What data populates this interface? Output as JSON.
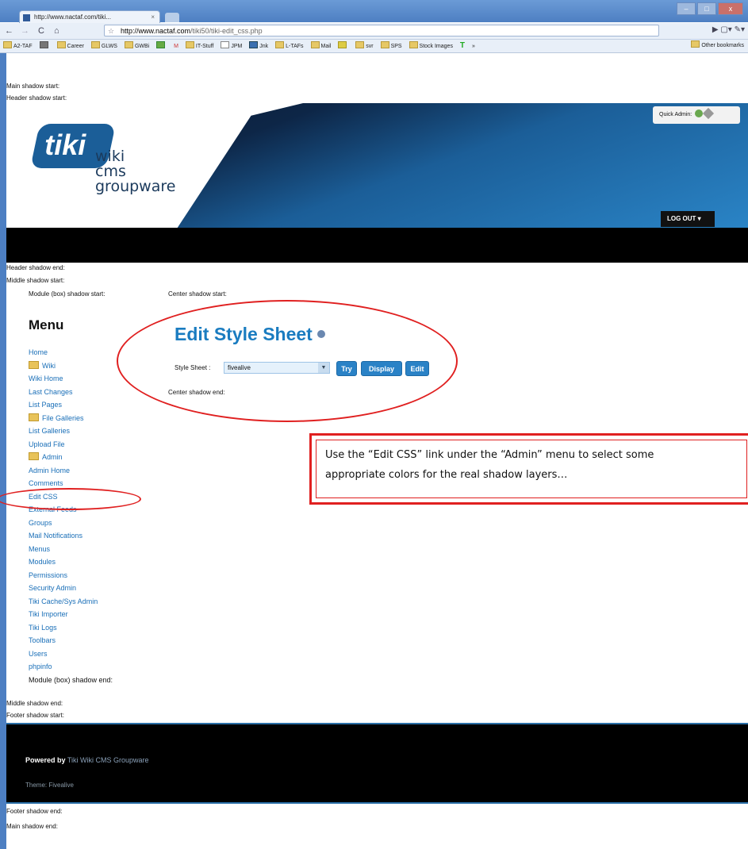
{
  "browser": {
    "tab_title": "http://www.nactaf.com/tiki...",
    "tab_close": "×",
    "url_host": "http://www.nactaf.com",
    "url_path": "/tiki50/tiki-edit_css.php",
    "bookmarks": [
      "A2-TAF",
      "",
      "Career",
      "GLWS",
      "GWBi",
      "",
      "M",
      "IT-Stuff",
      "JPM",
      "Jnk",
      "L-TAFs",
      "Mail",
      "",
      "svr",
      "SPS",
      "Stock Images",
      "T",
      "»"
    ],
    "other_bookmarks": "Other bookmarks"
  },
  "labels": {
    "main_start": "Main shadow start:",
    "header_start": "Header shadow start:",
    "header_end": "Header shadow end:",
    "middle_start": "Middle shadow start:",
    "module_start": "Module (box) shadow start:",
    "center_start": "Center shadow start:",
    "center_end": "Center shadow end:",
    "module_end": "Module (box) shadow end:",
    "middle_end": "Middle shadow end:",
    "footer_start": "Footer shadow start:",
    "footer_end": "Footer shadow end:",
    "main_end": "Main shadow end:"
  },
  "header": {
    "logo_tiki": "tiki",
    "logo_line1": "wiki",
    "logo_line2": "cms",
    "logo_line3": "groupware",
    "quick_admin": "Quick Admin:",
    "logout": "LOG OUT ▾"
  },
  "menu": {
    "title": "Menu",
    "items": [
      {
        "label": "Home",
        "folder": false
      },
      {
        "label": "Wiki",
        "folder": true
      },
      {
        "label": "Wiki Home",
        "folder": false
      },
      {
        "label": "Last Changes",
        "folder": false
      },
      {
        "label": "List Pages",
        "folder": false
      },
      {
        "label": "File Galleries",
        "folder": true
      },
      {
        "label": "List Galleries",
        "folder": false
      },
      {
        "label": "Upload File",
        "folder": false
      },
      {
        "label": "Admin",
        "folder": true
      },
      {
        "label": "Admin Home",
        "folder": false
      },
      {
        "label": "Comments",
        "folder": false
      },
      {
        "label": "Edit CSS",
        "folder": false
      },
      {
        "label": "External Feeds",
        "folder": false
      },
      {
        "label": "Groups",
        "folder": false
      },
      {
        "label": "Mail Notifications",
        "folder": false
      },
      {
        "label": "Menus",
        "folder": false
      },
      {
        "label": "Modules",
        "folder": false
      },
      {
        "label": "Permissions",
        "folder": false
      },
      {
        "label": "Security Admin",
        "folder": false
      },
      {
        "label": "Tiki Cache/Sys Admin",
        "folder": false
      },
      {
        "label": "Tiki Importer",
        "folder": false
      },
      {
        "label": "Tiki Logs",
        "folder": false
      },
      {
        "label": "Toolbars",
        "folder": false
      },
      {
        "label": "Users",
        "folder": false
      },
      {
        "label": "phpinfo",
        "folder": false
      }
    ]
  },
  "center": {
    "title": "Edit Style Sheet",
    "style_sheet_label": "Style Sheet :",
    "style_sheet_value": "fivealive",
    "btn_try": "Try",
    "btn_display": "Display",
    "btn_edit": "Edit"
  },
  "callout": {
    "line1": "Use the “Edit CSS” link under the “Admin” menu to select some",
    "line2": "appropriate colors for the real shadow layers…"
  },
  "footer": {
    "powered_by": "Powered by",
    "powered_link": "Tiki Wiki CMS Groupware",
    "theme": "Theme: Fivealive"
  },
  "colors": {
    "annotation_red": "#e02020",
    "link_blue": "#1a6fb8",
    "title_blue": "#1a7cc0",
    "button_blue": "#2a82c6"
  }
}
